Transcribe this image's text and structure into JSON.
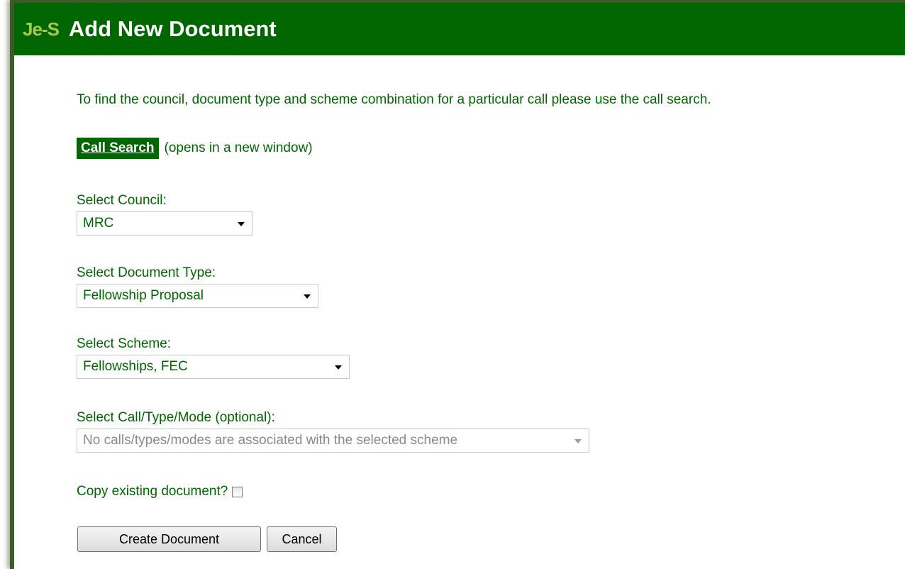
{
  "header": {
    "logo": "Je-S",
    "title": "Add New Document"
  },
  "intro_text": "To find the council, document type and scheme combination for a particular call please use the call search.",
  "call_search": {
    "button_label": "Call Search",
    "note": "(opens in a new window)"
  },
  "fields": {
    "council": {
      "label": "Select Council:",
      "value": "MRC"
    },
    "document_type": {
      "label": "Select Document Type:",
      "value": "Fellowship Proposal"
    },
    "scheme": {
      "label": "Select Scheme:",
      "value": "Fellowships, FEC"
    },
    "call_type_mode": {
      "label": "Select Call/Type/Mode (optional):",
      "value": "No calls/types/modes are associated with the selected scheme"
    }
  },
  "copy_existing": {
    "label": "Copy existing document?",
    "checked": false
  },
  "actions": {
    "create_label": "Create Document",
    "cancel_label": "Cancel"
  },
  "colors": {
    "brand_green": "#006600",
    "logo_green": "#9ccf4a",
    "text_green": "#006600"
  }
}
